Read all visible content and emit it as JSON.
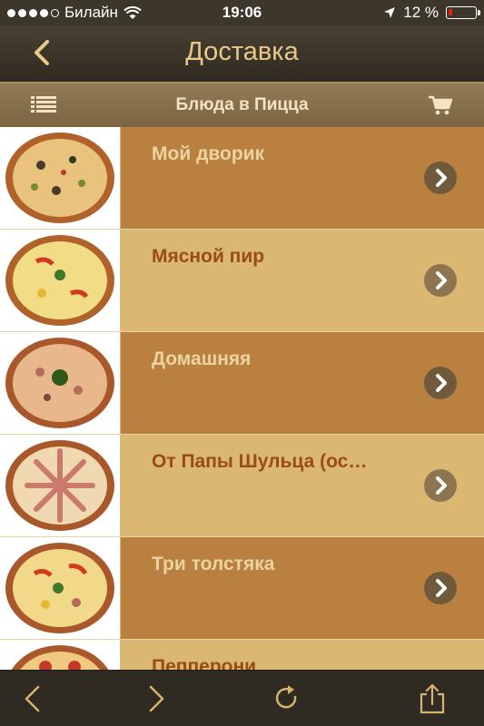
{
  "status_bar": {
    "carrier": "Билайн",
    "time": "19:06",
    "battery": "12 %",
    "signal_icon": "signal-dots-icon",
    "wifi_icon": "wifi-icon",
    "location_icon": "location-arrow-icon",
    "battery_icon": "battery-low-icon",
    "battery_level": 0.12
  },
  "header": {
    "title": "Доставка",
    "back_icon": "chevron-left-icon"
  },
  "subheader": {
    "title": "Блюда в Пицца",
    "menu_icon": "list-icon",
    "cart_icon": "cart-icon"
  },
  "dishes": [
    {
      "name": "Мой дворик",
      "image": "pizza-thumbnail"
    },
    {
      "name": "Мясной пир",
      "image": "pizza-thumbnail"
    },
    {
      "name": "Домашняя",
      "image": "pizza-thumbnail"
    },
    {
      "name": "От Папы Шульца (ос…",
      "image": "pizza-thumbnail"
    },
    {
      "name": "Три толстяка",
      "image": "pizza-thumbnail"
    },
    {
      "name": "Пепперони",
      "image": "pizza-thumbnail"
    }
  ],
  "toolbar": {
    "back_icon": "arrow-back-icon",
    "forward_icon": "arrow-forward-icon",
    "reload_icon": "reload-icon",
    "share_icon": "share-icon"
  },
  "colors": {
    "accent": "#e8c98a",
    "row_dark": "#b98040",
    "row_light": "#dab871",
    "name_on_light": "#9a4c14"
  }
}
